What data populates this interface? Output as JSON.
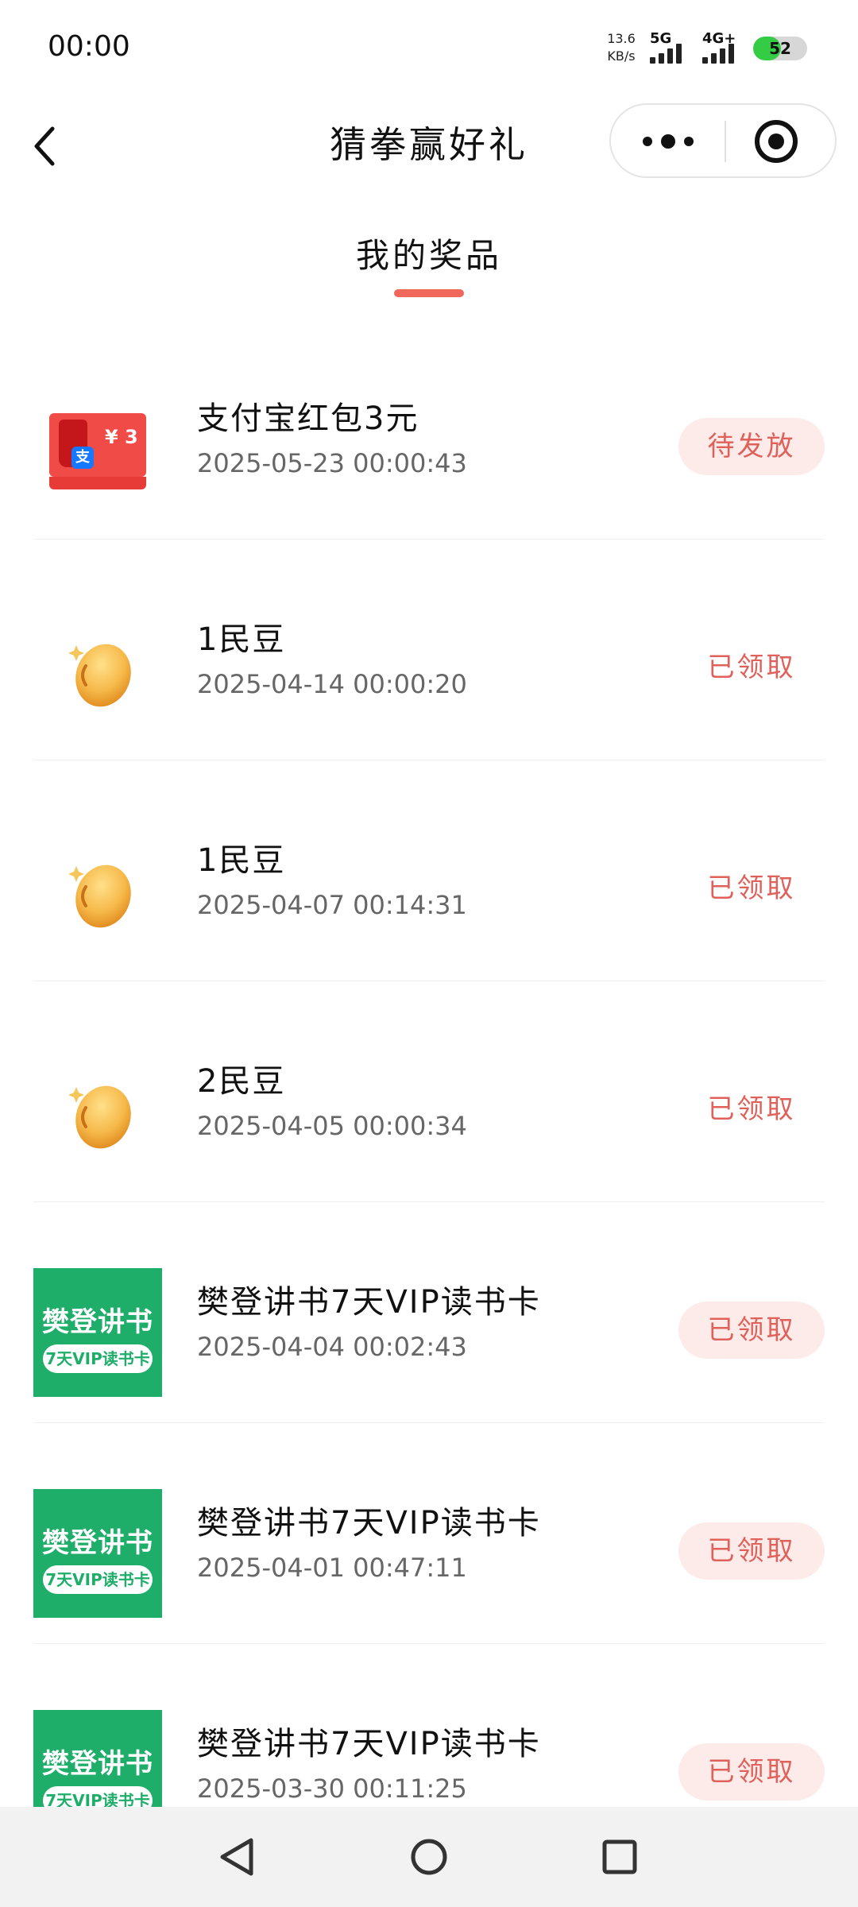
{
  "status_bar": {
    "time": "00:00",
    "net_speed_value": "13.6",
    "net_speed_unit": "KB/s",
    "signal_1": "5G",
    "signal_2": "4G+",
    "battery": "52",
    "battery_level_percent": 52,
    "battery_color": "#33cc44"
  },
  "nav": {
    "back_icon": "chevron-left-icon",
    "title": "猜拳赢好礼",
    "more_icon": "more-dots-icon",
    "close_icon": "target-circle-icon"
  },
  "tab": {
    "label": "我的奖品",
    "accent_color": "#f0675b"
  },
  "prizes": [
    {
      "name": "支付宝红包3元",
      "time": "2025-05-23 00:00:43",
      "status": "待发放",
      "thumb": "red-packet",
      "pill": true
    },
    {
      "name": "1民豆",
      "time": "2025-04-14 00:00:20",
      "status": "已领取",
      "thumb": "bean",
      "pill": false
    },
    {
      "name": "1民豆",
      "time": "2025-04-07 00:14:31",
      "status": "已领取",
      "thumb": "bean",
      "pill": false
    },
    {
      "name": "2民豆",
      "time": "2025-04-05 00:00:34",
      "status": "已领取",
      "thumb": "bean",
      "pill": false
    },
    {
      "name": "樊登讲书7天VIP读书卡",
      "time": "2025-04-04 00:02:43",
      "status": "已领取",
      "thumb": "book-card",
      "pill": true
    },
    {
      "name": "樊登讲书7天VIP读书卡",
      "time": "2025-04-01 00:47:11",
      "status": "已领取",
      "thumb": "book-card",
      "pill": true
    },
    {
      "name": "樊登讲书7天VIP读书卡",
      "time": "2025-03-30 00:11:25",
      "status": "已领取",
      "thumb": "book-card",
      "pill": true
    }
  ],
  "thumbs": {
    "red_packet_amount": "¥ 3",
    "red_packet_logo": "支",
    "book_title": "樊登讲书",
    "book_subtitle": "7天VIP读书卡"
  },
  "system_nav": {
    "back_icon": "triangle-back-icon",
    "home_icon": "circle-home-icon",
    "recents_icon": "square-recents-icon"
  }
}
